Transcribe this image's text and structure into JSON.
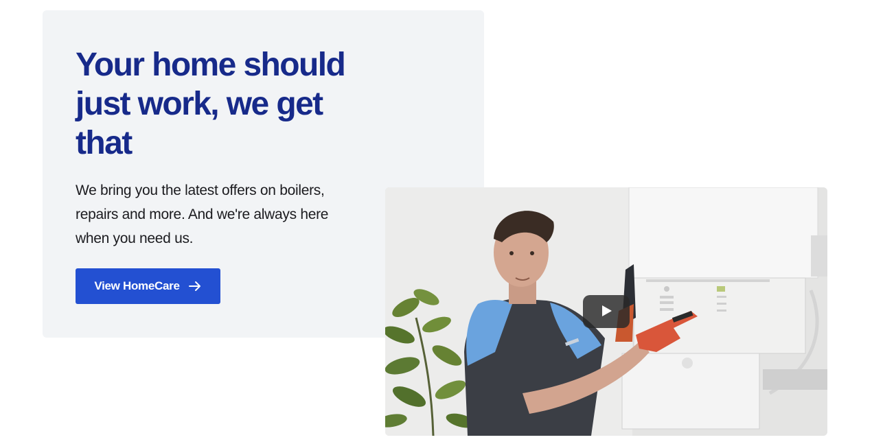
{
  "promo": {
    "headline": "Your home should just work, we get that",
    "body": "We bring you the latest offers on boilers, repairs and more. And we're always here when you need us.",
    "cta_label": "View HomeCare",
    "cta_icon": "arrow-right-icon"
  },
  "video": {
    "play_icon": "play-icon",
    "thumbnail_subject": "engineer-pointing-at-boiler"
  },
  "colors": {
    "headline": "#172a8a",
    "cta_background": "#2350d2",
    "card_background": "#f2f4f6",
    "body_text": "#1b1b1f"
  }
}
